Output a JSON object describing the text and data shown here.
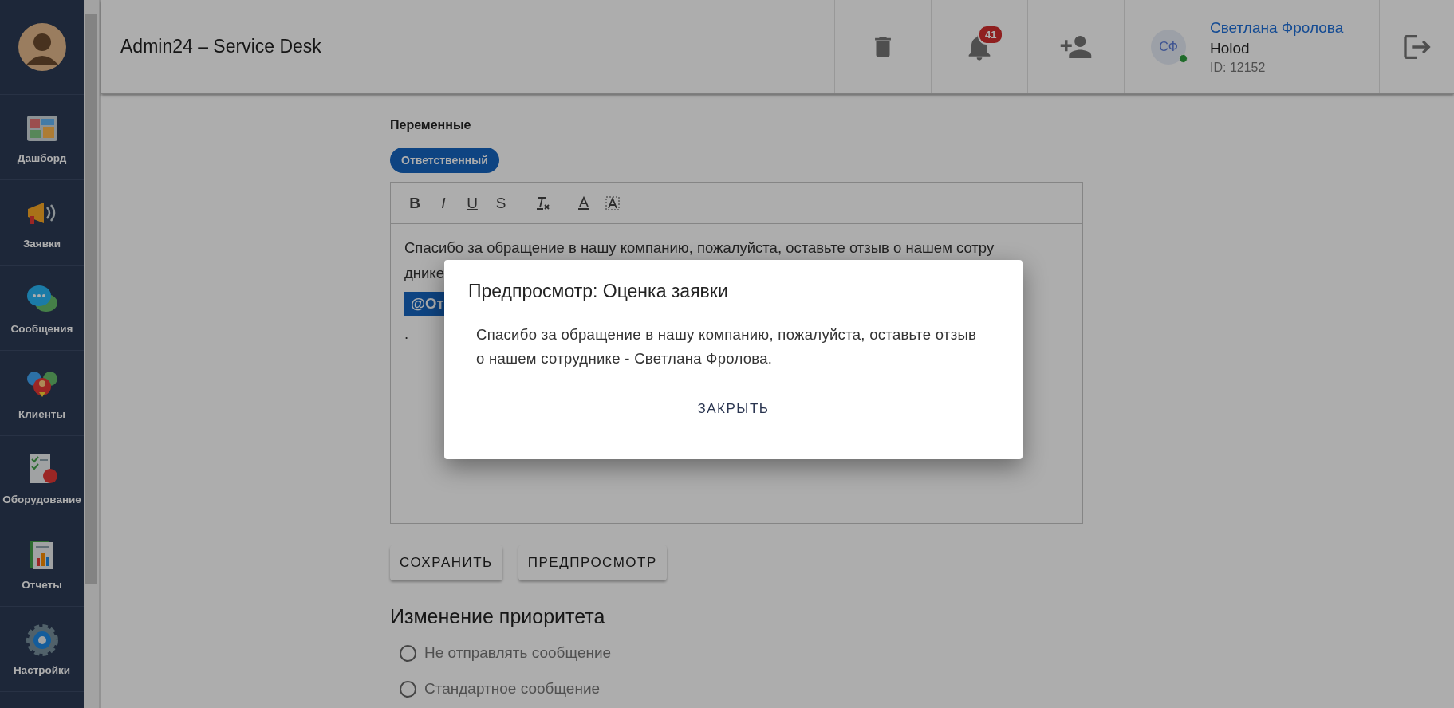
{
  "sidebar": {
    "items": [
      {
        "kind": "dashboard",
        "label": "Дашборд"
      },
      {
        "kind": "megaphone",
        "label": "Заявки"
      },
      {
        "kind": "chat",
        "label": "Сообщения"
      },
      {
        "kind": "people",
        "label": "Клиенты"
      },
      {
        "kind": "equipment",
        "label": "Оборудование"
      },
      {
        "kind": "report",
        "label": "Отчеты"
      },
      {
        "kind": "gear",
        "label": "Настройки"
      }
    ]
  },
  "header": {
    "title": "Admin24 – Service Desk",
    "actions": [
      {
        "kind": "trash"
      },
      {
        "kind": "bell",
        "badge": "41"
      },
      {
        "kind": "add-user"
      }
    ],
    "user": {
      "initials": "СФ",
      "online": true,
      "name": "Светлана Фролова",
      "company": "Holod",
      "id": "ID: 12152"
    }
  },
  "editor": {
    "variables_label": "Переменные",
    "variables": [
      "Ответственный"
    ],
    "toolbar": [
      {
        "kind": "bold",
        "glyph": "B"
      },
      {
        "kind": "italic",
        "glyph": "I"
      },
      {
        "kind": "underline",
        "glyph": "U"
      },
      {
        "kind": "strike",
        "glyph": "S"
      },
      {
        "kind": "clean"
      },
      {
        "kind": "color"
      },
      {
        "kind": "background"
      }
    ],
    "lines": [
      {
        "kind": "text",
        "text": "Спасибо за обращение в нашу компанию, пожалуйста, оставьте отзыв о нашем сотру"
      },
      {
        "kind": "text",
        "text": "днике"
      },
      {
        "kind": "mention",
        "text": "@От"
      },
      {
        "kind": "text",
        "text": "."
      }
    ],
    "buttons": [
      "СОХРАНИТЬ",
      "ПРЕДПРОСМОТР"
    ]
  },
  "priority": {
    "title": "Изменение приоритета",
    "options": [
      {
        "label": "Не отправлять сообщение",
        "selected": false
      },
      {
        "label": "Стандартное сообщение",
        "selected": false
      }
    ]
  },
  "dialog": {
    "title": "Предпросмотр: Оценка заявки",
    "body": "Спасибо за обращение в нашу компанию, пожалуйста, оставьте отзыв о нашем сотруднике - Светлана Фролова.",
    "button": "ЗАКРЫТЬ"
  }
}
